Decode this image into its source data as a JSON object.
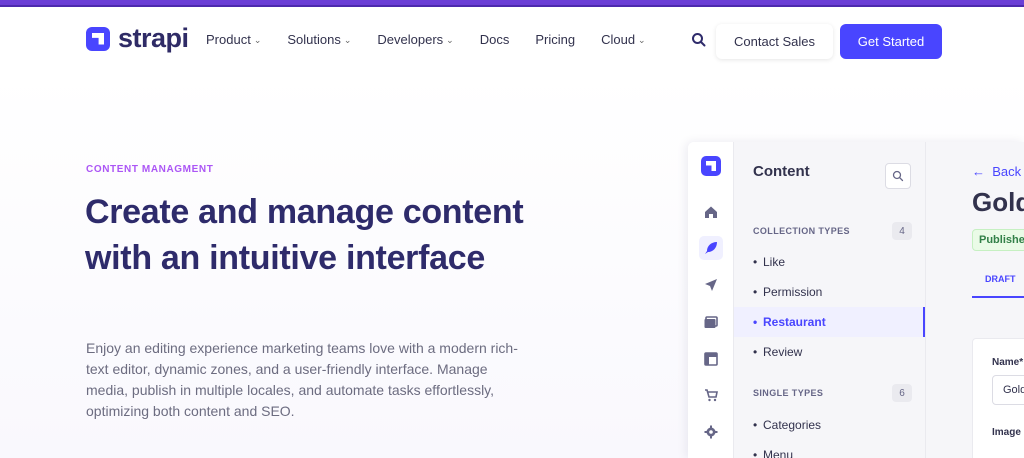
{
  "brand": {
    "name": "strapi",
    "color": "#4945ff",
    "topbar_color": "#6b3fd6"
  },
  "nav": {
    "items": [
      {
        "label": "Product",
        "dropdown": true
      },
      {
        "label": "Solutions",
        "dropdown": true
      },
      {
        "label": "Developers",
        "dropdown": true
      },
      {
        "label": "Docs",
        "dropdown": false
      },
      {
        "label": "Pricing",
        "dropdown": false
      },
      {
        "label": "Cloud",
        "dropdown": true
      }
    ],
    "search_icon": "search-icon",
    "contact_label": "Contact Sales",
    "cta_label": "Get Started"
  },
  "hero": {
    "eyebrow": "CONTENT MANAGMENT",
    "title": "Create and manage content with an intuitive interface",
    "description": "Enjoy an editing experience marketing teams love with a modern rich-text editor, dynamic zones, and a user-friendly interface. Manage media, publish in multiple locales, and automate tasks effortlessly, optimizing both content and SEO."
  },
  "mock_app": {
    "rail_icons": [
      "home-icon",
      "feather-icon",
      "send-icon",
      "media-icon",
      "layout-icon",
      "cart-icon",
      "settings-icon"
    ],
    "panel": {
      "title": "Content",
      "collection_types_label": "COLLECTION TYPES",
      "collection_types_count": "4",
      "collection_types": [
        "Like",
        "Permission",
        "Restaurant",
        "Review"
      ],
      "active_item": "Restaurant",
      "single_types_label": "SINGLE TYPES",
      "single_types_count": "6",
      "single_types": [
        "Categories",
        "Menu"
      ]
    },
    "editor": {
      "back_label": "Back",
      "title": "Gold",
      "status_badge": "Publishe",
      "tab_label": "DRAFT",
      "name_label": "Name*",
      "name_value": "Gold",
      "image_label": "Image"
    }
  }
}
